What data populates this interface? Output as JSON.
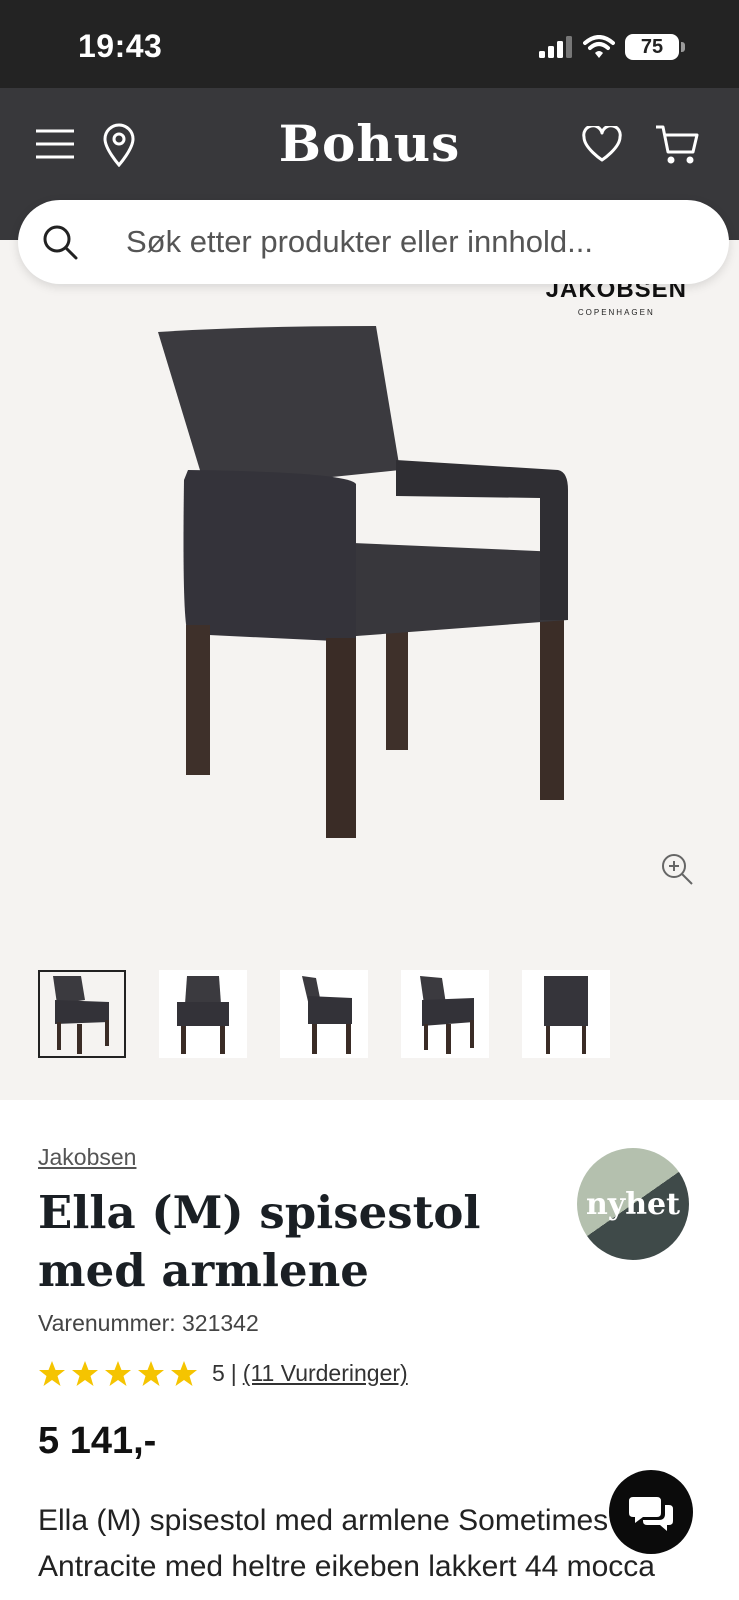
{
  "status_bar": {
    "time": "19:43",
    "battery": "75"
  },
  "header": {
    "brand": "Bohus",
    "icons": [
      "menu-icon",
      "location-pin-icon",
      "heart-icon",
      "cart-icon"
    ]
  },
  "search": {
    "placeholder": "Søk etter produkter eller innhold..."
  },
  "gallery": {
    "brand_mark": "JAKOBSEN",
    "brand_mark_sub": "COPENHAGEN",
    "thumbnail_count": 5,
    "active_thumbnail": 1
  },
  "product": {
    "brand": "Jakobsen",
    "title": "Ella (M) spisestol med armlene",
    "badge": "nyhet",
    "sku": "Varenummer: 321342",
    "rating_value": "5",
    "rating_separator": "|",
    "reviews": "(11 Vurderinger)",
    "stars": 5,
    "price": "5 141,-",
    "description_line1": "Ella (M) spisestol med armlene Sometimes",
    "description_line2": "Antracite med heltre eikeben lakkert 44 mocca"
  },
  "colors": {
    "header": "#38383b",
    "status_bar": "#232323",
    "star": "#f5c400",
    "badge_light": "#b4c0ae",
    "badge_dark": "#3f4a49"
  }
}
